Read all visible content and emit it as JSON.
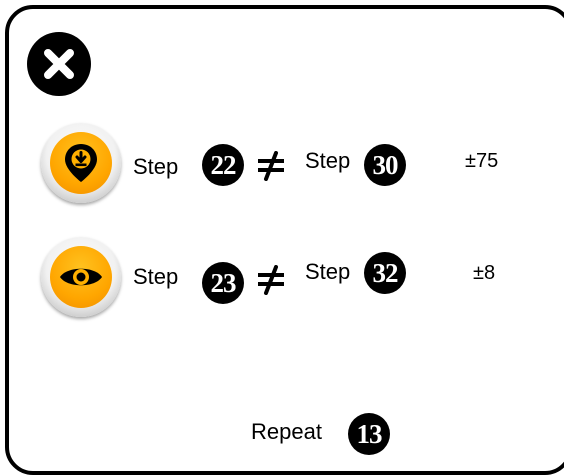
{
  "close_button": {
    "icon": "close-icon"
  },
  "rows": [
    {
      "icon": "location-pin-download-icon",
      "left_label": "Step",
      "left_value": "22",
      "relation": "≠",
      "right_label": "Step",
      "right_value": "30",
      "difference": "±75"
    },
    {
      "icon": "eye-icon",
      "left_label": "Step",
      "left_value": "23",
      "relation": "≠",
      "right_label": "Step",
      "right_value": "32",
      "difference": "±8"
    }
  ],
  "repeat": {
    "label": "Repeat",
    "value": "13"
  },
  "colors": {
    "badge_orange": "#ffa600",
    "badge_ring": "#d9d9d9",
    "border": "#000000"
  }
}
